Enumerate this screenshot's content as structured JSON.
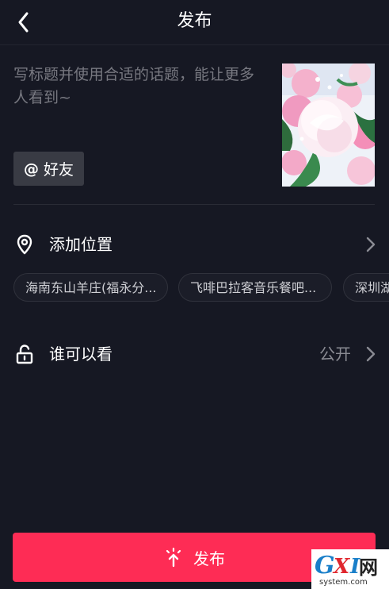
{
  "header": {
    "title": "发布"
  },
  "caption": {
    "placeholder": "写标题并使用合适的话题，能让更多人看到~"
  },
  "mention": {
    "label": "好友"
  },
  "location": {
    "label": "添加位置",
    "suggestions": [
      "海南东山羊庄(福永分...",
      "飞啡巴拉客音乐餐吧...",
      "深圳湖"
    ]
  },
  "privacy": {
    "label": "谁可以看",
    "value": "公开"
  },
  "publish": {
    "label": "发布"
  },
  "watermark": {
    "brand_text": "GXI网",
    "site_text": "system.com"
  },
  "colors": {
    "background": "#161823",
    "accent": "#fe2c55",
    "chip_bg": "#393b44",
    "muted_text": "#777880"
  },
  "icons": {
    "back": "chevron-left-icon",
    "location": "location-pin-icon",
    "privacy": "unlock-icon",
    "publish": "publish-spark-icon",
    "chevron": "chevron-right-icon"
  }
}
